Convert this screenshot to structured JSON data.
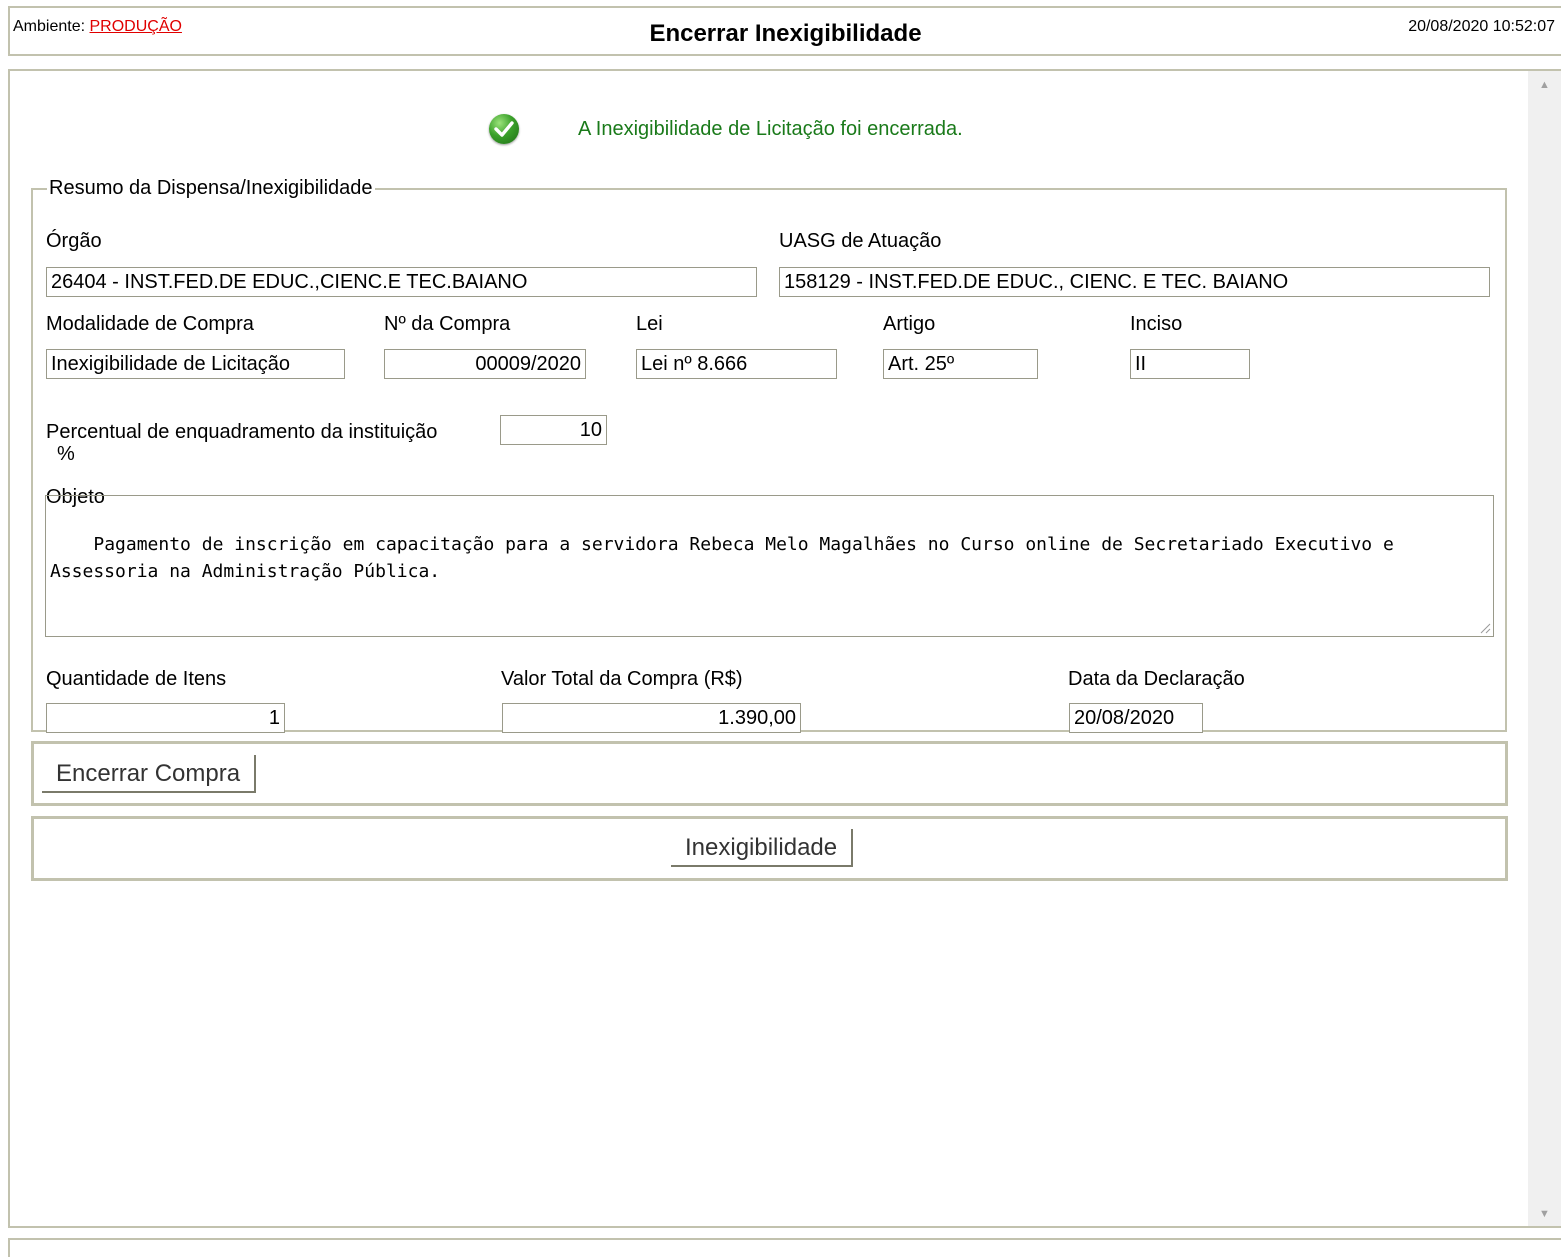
{
  "header": {
    "env_label": "Ambiente:",
    "env_value": "PRODUÇÃO",
    "title": "Encerrar Inexigibilidade",
    "datetime": "20/08/2020 10:52:07"
  },
  "message": {
    "text": "A Inexigibilidade de Licitação foi encerrada.",
    "icon": "success-check-icon",
    "color": "#1a7a1a"
  },
  "resumo": {
    "legend": "Resumo da Dispensa/Inexigibilidade",
    "orgao_label": "Órgão",
    "orgao_value": "26404 - INST.FED.DE EDUC.,CIENC.E TEC.BAIANO",
    "uasg_label": "UASG de Atuação",
    "uasg_value": "158129 - INST.FED.DE EDUC., CIENC. E TEC. BAIANO",
    "modalidade_label": "Modalidade de Compra",
    "modalidade_value": "Inexigibilidade de Licitação",
    "numero_label": "Nº da Compra",
    "numero_value": "00009/2020",
    "lei_label": "Lei",
    "lei_value": "Lei nº 8.666",
    "artigo_label": "Artigo",
    "artigo_value": "Art. 25º",
    "inciso_label": "Inciso",
    "inciso_value": "II",
    "percentual_label": "Percentual de enquadramento da instituição",
    "percentual_unit": "%",
    "percentual_value": "10",
    "objeto_label": "Objeto",
    "objeto_value": "Pagamento de inscrição em capacitação para a servidora Rebeca Melo Magalhães no Curso online de Secretariado Executivo e Assessoria na Administração Pública.",
    "quantidade_label": "Quantidade de Itens",
    "quantidade_value": "1",
    "valor_label": "Valor Total da Compra (R$)",
    "valor_value": "1.390,00",
    "data_label": "Data da Declaração",
    "data_value": "20/08/2020"
  },
  "actions": {
    "encerrar_label": "Encerrar Compra",
    "inexigibilidade_label": "Inexigibilidade"
  },
  "colors": {
    "env_link": "#e00000",
    "border": "#c2c2ae",
    "success_text": "#1a7a1a"
  }
}
